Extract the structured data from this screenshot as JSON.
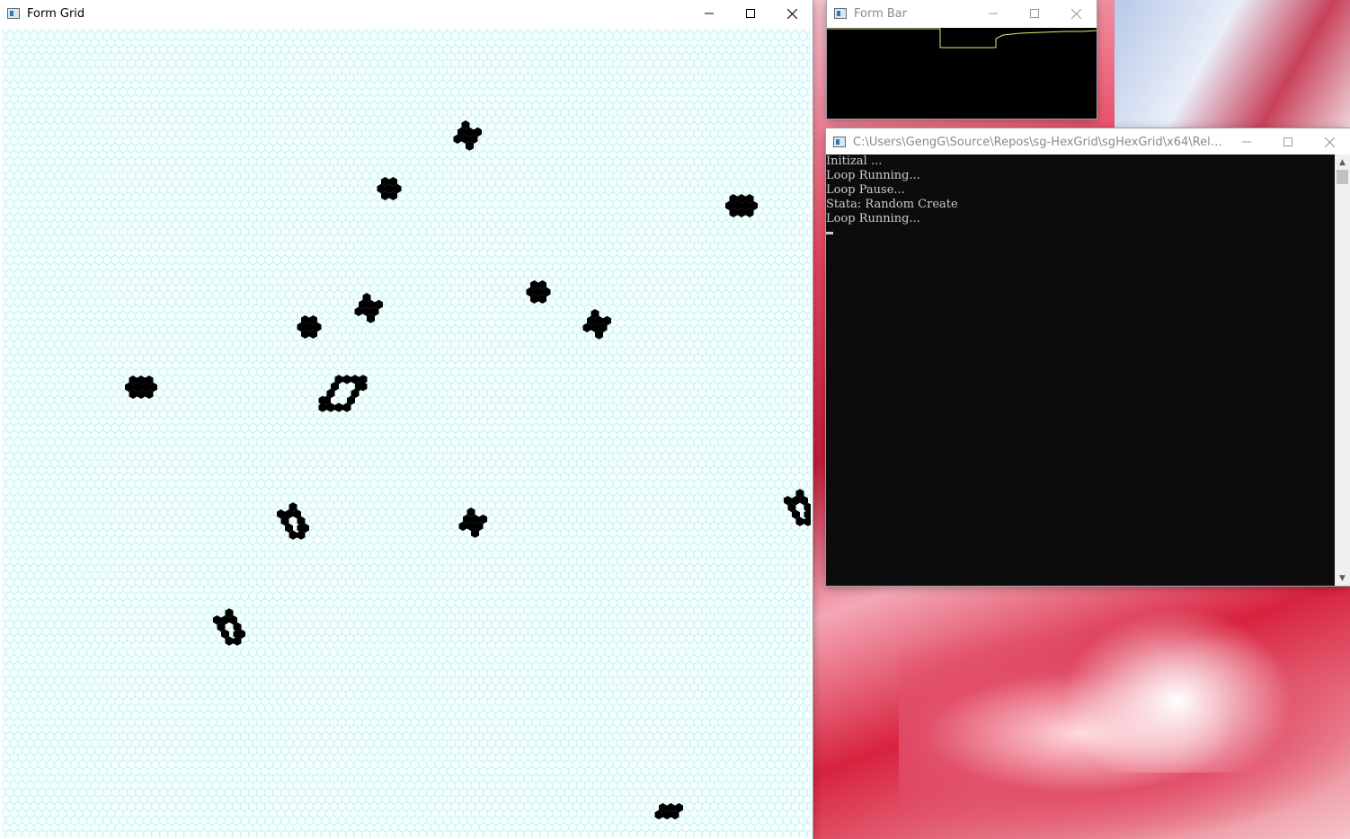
{
  "grid_window": {
    "title": "Form Grid",
    "icon": "app-window-icon",
    "controls": {
      "minimize": "minimize-icon",
      "maximize": "maximize-icon",
      "close": "close-icon"
    },
    "colors": {
      "grid_line": "#bff0f0",
      "background": "#f4fffe",
      "live_cell": "#000000"
    }
  },
  "bar_window": {
    "title": "Form Bar",
    "icon": "app-window-icon",
    "colors": {
      "background": "#000000",
      "line": "#e8e87a"
    }
  },
  "console_window": {
    "title": "C:\\Users\\GengG\\Source\\Repos\\sg-HexGrid\\sgHexGrid\\x64\\Release\\s...",
    "icon": "console-icon",
    "lines": [
      "Initizal ...",
      "Loop Running...",
      "Loop Pause...",
      "Stata: Random Create",
      "Loop Running..."
    ],
    "colors": {
      "background": "#0c0c0c",
      "text": "#cccccc"
    }
  }
}
